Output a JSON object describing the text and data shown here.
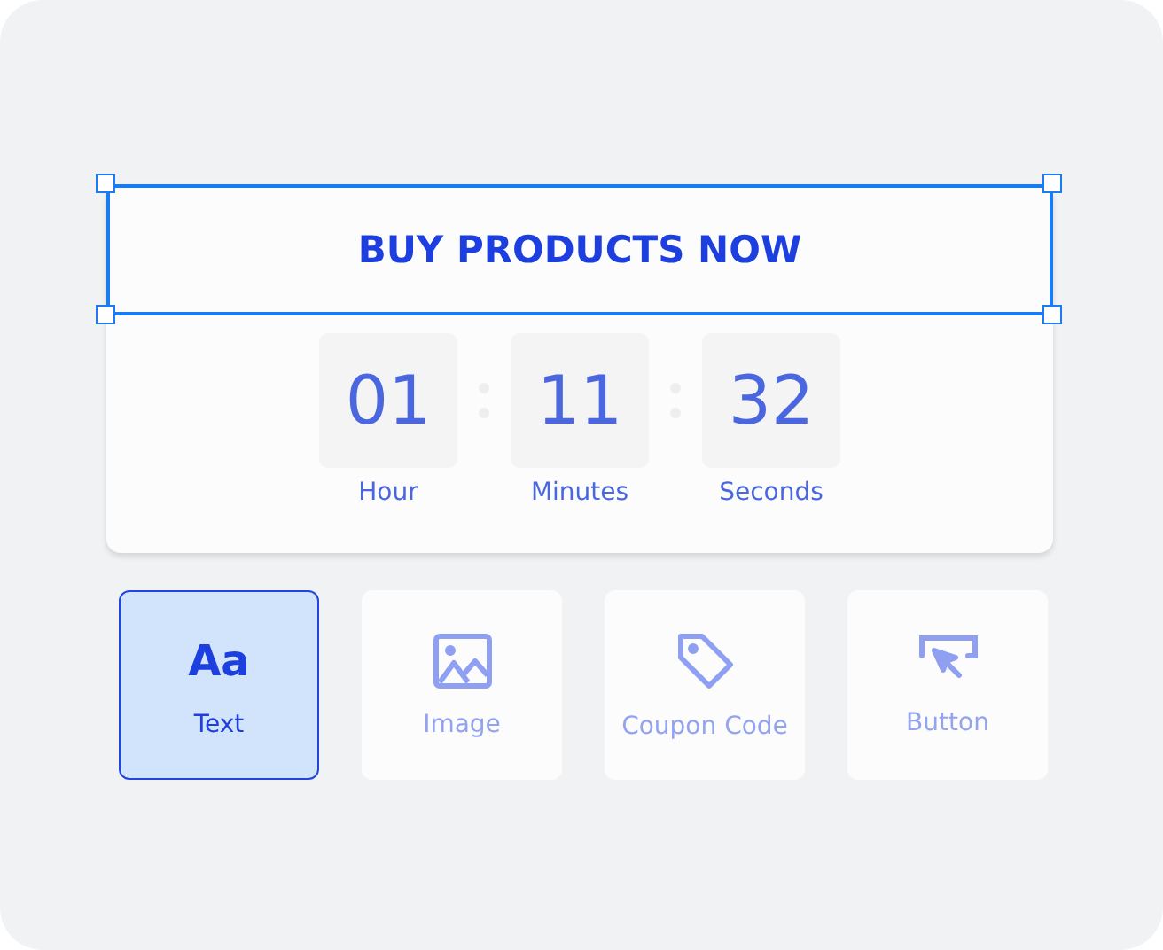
{
  "banner": {
    "text": "BUY PRODUCTS NOW",
    "selected": true
  },
  "timer": [
    {
      "value": "01",
      "label": "Hour"
    },
    {
      "value": "11",
      "label": "Minutes"
    },
    {
      "value": "32",
      "label": "Seconds"
    }
  ],
  "tools": [
    {
      "kind": "text",
      "glyph": "Aa",
      "label": "Text",
      "selected": true
    },
    {
      "kind": "image",
      "label": "Image",
      "selected": false
    },
    {
      "kind": "coupon",
      "label": "Coupon Code",
      "selected": false
    },
    {
      "kind": "button",
      "label": "Button",
      "selected": false
    }
  ]
}
